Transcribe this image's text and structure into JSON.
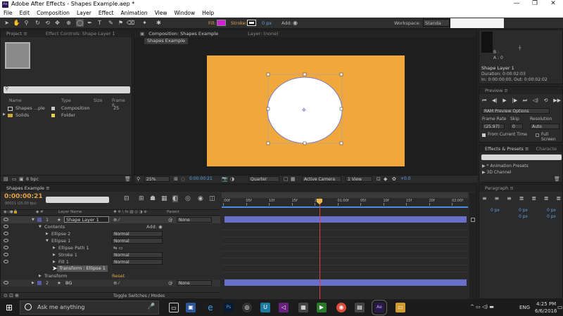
{
  "app": {
    "title": "Adobe After Effects - Shapes Example.aep *"
  },
  "menu": [
    "File",
    "Edit",
    "Composition",
    "Layer",
    "Effect",
    "Animation",
    "View",
    "Window",
    "Help"
  ],
  "toolbar": {
    "fill_label": "Fill:",
    "stroke_label": "Stroke:",
    "stroke_px": "0 px",
    "add_label": "Add:",
    "workspace_label": "Workspace:",
    "workspace_value": "Standa",
    "fill_color": "#d020d0",
    "stroke_color": "#ffffff"
  },
  "project_panel": {
    "tab_project": "Project ≡",
    "tab_effect_controls": "Effect Controls: Shape Layer 1",
    "columns": [
      "Name",
      "Type",
      "Size",
      "Frame R..."
    ],
    "items": [
      {
        "name": "Shapes ...ple",
        "type": "Composition",
        "size": "",
        "frame": "25",
        "color": "#c8c8c8"
      },
      {
        "name": "Solids",
        "type": "Folder",
        "size": "",
        "frame": "",
        "color": "#e8d24a"
      }
    ],
    "bpc": "8 bpc"
  },
  "comp_panel": {
    "tab_comp": "Composition: Shapes Example",
    "tab_layer": "Layer: (none)",
    "breadcrumb": "Shapes Example",
    "zoom": "25%",
    "timecode": "0:00:00:21",
    "resolution": "Quarter",
    "camera": "Active Camera",
    "view": "1 View",
    "exposure": "+0.0",
    "bg_color": "#f0a83a"
  },
  "info_panel": {
    "values": [
      "B :",
      "A : 0"
    ],
    "layer": "Shape Layer 1",
    "duration": "Duration: 0:00:02:03",
    "inout": "In: 0:00:00:00, Out: 0:00:02:02"
  },
  "preview_panel": {
    "title": "Preview ≡",
    "ram": "RAM Preview Options",
    "frame_rate_label": "Frame Rate",
    "skip_label": "Skip",
    "resolution_label": "Resolution",
    "frame_rate": "(25.97)",
    "skip": "0",
    "resolution": "Auto",
    "from_current": "From Current Time",
    "full_screen": "Full Screen"
  },
  "effects_panel": {
    "title": "Effects & Presets ≡",
    "tab2": "Characte",
    "items": [
      "* Animation Presets",
      "3D Channel"
    ]
  },
  "paragraph_panel": {
    "title": "Paragraph ≡",
    "values": [
      "0 px",
      "0 px",
      "0 px",
      "0 px",
      "0 px"
    ]
  },
  "timeline": {
    "tab": "Shapes Example ≡",
    "timecode": "0:00:00:21",
    "timecode_sub": "00021 (25.00 fps)",
    "col_layer": "Layer Name",
    "col_parent": "Parent",
    "toggle_label": "Toggle Switches / Modes",
    "ruler": [
      ":00f",
      "05f",
      "10f",
      "15f",
      "20f",
      "01:00f",
      "05f",
      "10f",
      "15f",
      "20f",
      "02:00f"
    ],
    "layers": [
      {
        "num": "1",
        "name": "Shape Layer 1",
        "parent": "None"
      },
      {
        "contents": "Contents",
        "add": "Add:"
      },
      {
        "name": "Ellipse 2",
        "mode": "Normal"
      },
      {
        "name": "Ellipse 1",
        "mode": "Normal"
      },
      {
        "name": "Ellipse Path 1"
      },
      {
        "name": "Stroke 1",
        "mode": "Normal"
      },
      {
        "name": "Fill 1",
        "mode": "Normal"
      },
      {
        "name": "Transform : Ellipse 1"
      },
      {
        "name": "Transform",
        "reset": "Reset"
      },
      {
        "num": "2",
        "name": "BG",
        "parent": "None"
      }
    ]
  },
  "taskbar": {
    "search": "Ask me anything",
    "time": "4:25 PM",
    "date": "6/6/2016",
    "lang": "ENG"
  }
}
